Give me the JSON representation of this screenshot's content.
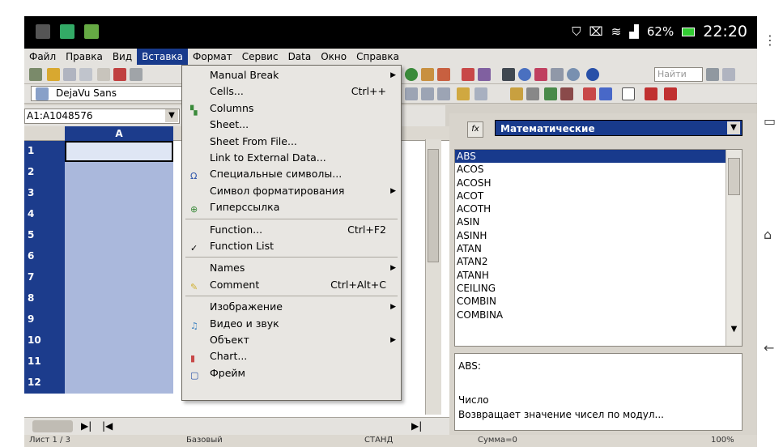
{
  "status_bar": {
    "battery": "62%",
    "time": "22:20"
  },
  "menubar": [
    {
      "label": "Файл"
    },
    {
      "label": "Правка"
    },
    {
      "label": "Вид"
    },
    {
      "label": "Вставка",
      "active": true
    },
    {
      "label": "Формат"
    },
    {
      "label": "Сервис"
    },
    {
      "label": "Data"
    },
    {
      "label": "Окно"
    },
    {
      "label": "Справка"
    }
  ],
  "toolbar": {
    "font_name": "DejaVu Sans",
    "find_placeholder": "Найти"
  },
  "namebox": {
    "value": "A1:A1048576"
  },
  "grid": {
    "column_header": "A",
    "rows": [
      "1",
      "2",
      "3",
      "4",
      "5",
      "6",
      "7",
      "8",
      "9",
      "10",
      "11",
      "12"
    ]
  },
  "insert_menu": [
    {
      "label": "Manual Break",
      "submenu": true
    },
    {
      "label": "Cells...",
      "shortcut": "Ctrl++"
    },
    {
      "label": "Columns",
      "icon": "columns-icon"
    },
    {
      "label": "Sheet..."
    },
    {
      "label": "Sheet From File..."
    },
    {
      "label": "Link to External Data..."
    },
    {
      "label": "Специальные символы...",
      "icon": "special-char-icon"
    },
    {
      "label": "Символ форматирования",
      "submenu": true
    },
    {
      "label": "Гиперссылка",
      "icon": "hyperlink-icon"
    },
    {
      "separator": true
    },
    {
      "label": "Function...",
      "shortcut": "Ctrl+F2"
    },
    {
      "label": "Function List",
      "checked": true
    },
    {
      "separator": true
    },
    {
      "label": "Names",
      "submenu": true
    },
    {
      "label": "Comment",
      "shortcut": "Ctrl+Alt+C",
      "icon": "comment-icon"
    },
    {
      "separator": true
    },
    {
      "label": "Изображение",
      "submenu": true
    },
    {
      "label": "Видео и звук",
      "icon": "video-icon"
    },
    {
      "label": "Объект",
      "submenu": true
    },
    {
      "label": "Chart...",
      "icon": "chart-icon"
    },
    {
      "label": "Фрейм",
      "icon": "frame-icon"
    }
  ],
  "function_panel": {
    "category": "Математические",
    "functions": [
      "ABS",
      "ACOS",
      "ACOSH",
      "ACOT",
      "ACOTH",
      "ASIN",
      "ASINH",
      "ATAN",
      "ATAN2",
      "ATANH",
      "CEILING",
      "COMBIN",
      "COMBINA"
    ],
    "selected": "ABS",
    "description_name": "ABS:",
    "argument": "Число",
    "description": "Возвращает значение чисел по модул..."
  },
  "statusline": {
    "sheet": "Лист 1 / 3",
    "style": "Базовый",
    "mode": "СТАНД",
    "sum": "Сумма=0",
    "zoom": "100%"
  },
  "colors": {
    "selection": "#183a8c",
    "grid_selected": "#aab8dc"
  }
}
